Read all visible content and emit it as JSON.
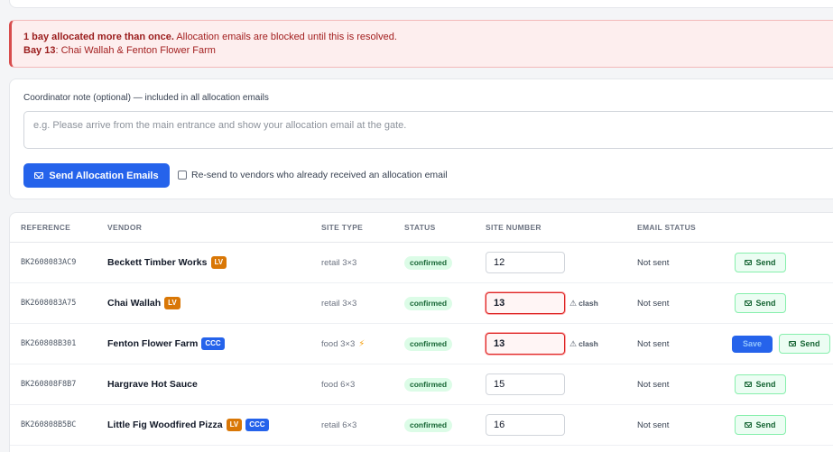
{
  "alert": {
    "headline": "1 bay allocated more than once.",
    "message": " Allocation emails are blocked until this is resolved.",
    "bay_label": "Bay 13",
    "bay_detail": ": Chai Wallah & Fenton Flower Farm"
  },
  "note": {
    "label": "Coordinator note (optional) — included in all allocation emails",
    "placeholder": "e.g. Please arrive from the main entrance and show your allocation email at the gate.",
    "value": ""
  },
  "send_all_label": "Send Allocation Emails",
  "resend_label": "Re-send to vendors who already received an allocation email",
  "table": {
    "columns": [
      "Reference",
      "Vendor",
      "Site Type",
      "Status",
      "Site Number",
      "Email Status"
    ],
    "rows": [
      {
        "reference": "BK2608083AC9",
        "vendor": "Beckett Timber Works",
        "tags": [
          "LV"
        ],
        "site_type": "retail 3×3",
        "electric": false,
        "status": "confirmed",
        "site_number": "12",
        "clash": false,
        "email_status": "Not sent",
        "dirty": false
      },
      {
        "reference": "BK2608083A75",
        "vendor": "Chai Wallah",
        "tags": [
          "LV"
        ],
        "site_type": "retail 3×3",
        "electric": false,
        "status": "confirmed",
        "site_number": "13",
        "clash": true,
        "email_status": "Not sent",
        "dirty": false
      },
      {
        "reference": "BK260808B301",
        "vendor": "Fenton Flower Farm",
        "tags": [
          "CCC"
        ],
        "site_type": "food 3×3",
        "electric": true,
        "status": "confirmed",
        "site_number": "13",
        "clash": true,
        "email_status": "Not sent",
        "dirty": true
      },
      {
        "reference": "BK260808F8B7",
        "vendor": "Hargrave Hot Sauce",
        "tags": [],
        "site_type": "food 6×3",
        "electric": false,
        "status": "confirmed",
        "site_number": "15",
        "clash": false,
        "email_status": "Not sent",
        "dirty": false
      },
      {
        "reference": "BK260808B5BC",
        "vendor": "Little Fig Woodfired Pizza",
        "tags": [
          "LV",
          "CCC"
        ],
        "site_type": "retail 6×3",
        "electric": false,
        "status": "confirmed",
        "site_number": "16",
        "clash": false,
        "email_status": "Not sent",
        "dirty": false
      }
    ]
  },
  "labels": {
    "clash": "clash",
    "send": "Send",
    "save": "Save"
  },
  "icons": {
    "send": "mail-icon",
    "clash": "warning-icon",
    "electric": "lightning-icon"
  },
  "colors": {
    "primary": "#2563eb",
    "danger": "#dc2626",
    "success": "#166534",
    "tag_lv": "#d97706",
    "tag_ccc": "#2563eb"
  }
}
